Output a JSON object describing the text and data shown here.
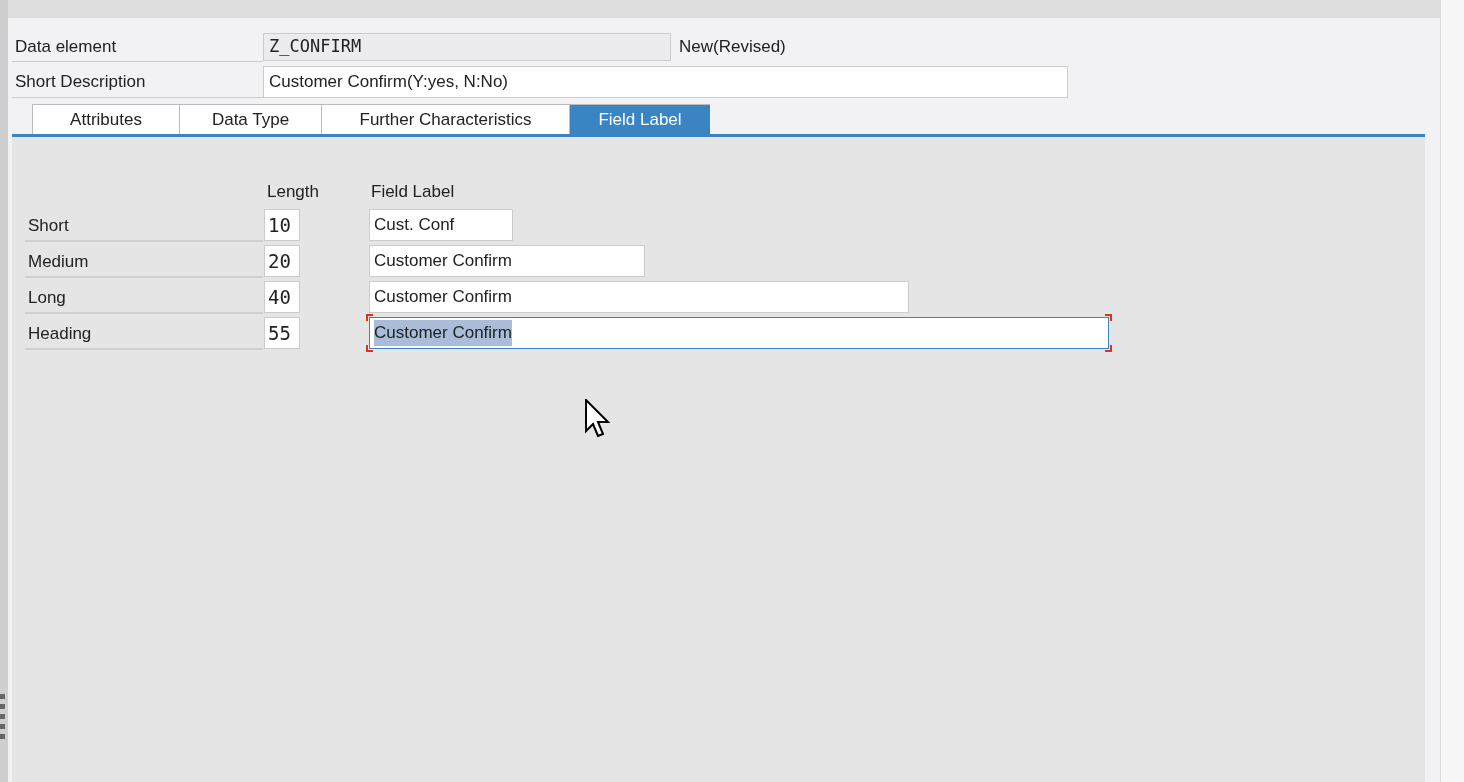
{
  "header": {
    "data_element": {
      "label": "Data element",
      "value": "Z_CONFIRM",
      "status": "New(Revised)"
    },
    "short_description": {
      "label": "Short Description",
      "value": "Customer Confirm(Y:yes, N:No)"
    }
  },
  "tabs": [
    {
      "label": "Attributes",
      "selected": false
    },
    {
      "label": "Data Type",
      "selected": false
    },
    {
      "label": "Further Characteristics",
      "selected": false
    },
    {
      "label": "Field Label",
      "selected": true
    }
  ],
  "field_labels": {
    "columns": [
      "Length",
      "Field Label"
    ],
    "rows": [
      {
        "name": "Short",
        "length": "10",
        "label": "Cust. Conf",
        "focused": false
      },
      {
        "name": "Medium",
        "length": "20",
        "label": "Customer Confirm",
        "focused": false
      },
      {
        "name": "Long",
        "length": "40",
        "label": "Customer Confirm",
        "focused": false
      },
      {
        "name": "Heading",
        "length": "55",
        "label": "Customer Confirm",
        "focused": true
      }
    ]
  }
}
